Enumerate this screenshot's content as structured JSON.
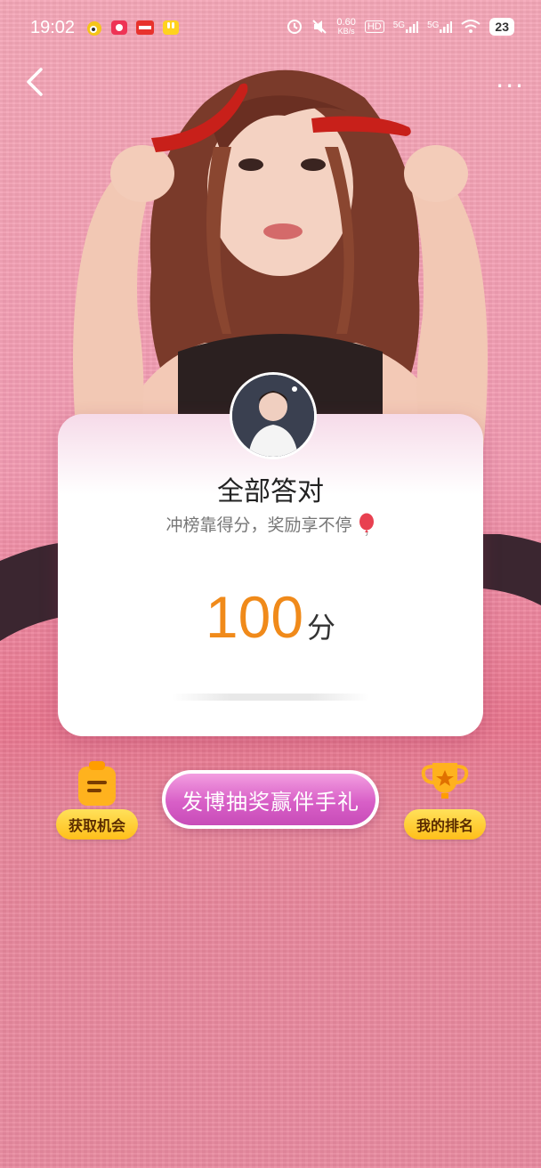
{
  "status_bar": {
    "time": "19:02",
    "speed_value": "0.60",
    "speed_unit": "KB/s",
    "battery": "23",
    "network_1": "5G",
    "network_2": "5G",
    "hd_label": "HD"
  },
  "header": {
    "back_icon": "chevron-left-icon",
    "more_label": "···"
  },
  "card": {
    "title": "全部答对",
    "subtitle": "冲榜靠得分，奖励享不停",
    "score": "100",
    "score_unit": "分"
  },
  "actions": {
    "left_label": "获取机会",
    "main_label": "发博抽奖赢伴手礼",
    "right_label": "我的排名"
  },
  "colors": {
    "score": "#f08a1a",
    "button_gradient_top": "#f39ee0",
    "button_gradient_bottom": "#c84cb8",
    "side_button": "#ffc72a"
  }
}
